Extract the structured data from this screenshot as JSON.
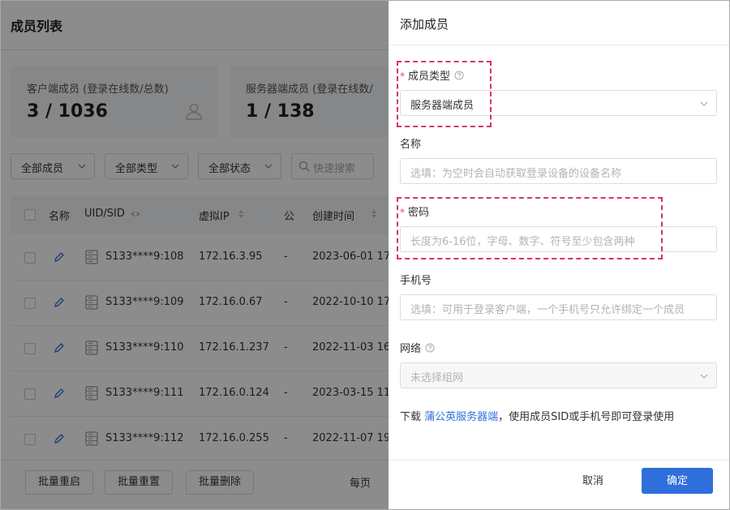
{
  "page": {
    "title": "成员列表",
    "stats": [
      {
        "label": "客户端成员 (登录在线数/总数)",
        "value": "3 / 1036"
      },
      {
        "label": "服务器端成员 (登录在线数/",
        "value": "1 / 138"
      }
    ],
    "filters": [
      "全部成员",
      "全部类型",
      "全部状态"
    ],
    "search_placeholder": "快速搜索",
    "columns": {
      "name": "名称",
      "uid": "UID/SID",
      "ip": "虚拟IP",
      "pub": "公",
      "created": "创建时间"
    },
    "rows": [
      {
        "sid": "S133****9:108",
        "ip": "172.16.3.95",
        "pub": "-",
        "created": "2023-06-01 17"
      },
      {
        "sid": "S133****9:109",
        "ip": "172.16.0.67",
        "pub": "-",
        "created": "2022-10-10 17"
      },
      {
        "sid": "S133****9:110",
        "ip": "172.16.1.237",
        "pub": "-",
        "created": "2022-11-03 16"
      },
      {
        "sid": "S133****9:111",
        "ip": "172.16.0.124",
        "pub": "-",
        "created": "2023-03-15 11"
      },
      {
        "sid": "S133****9:112",
        "ip": "172.16.0.255",
        "pub": "-",
        "created": "2022-11-07 19"
      }
    ],
    "footer": {
      "batch_restart": "批量重启",
      "batch_reset": "批量重置",
      "batch_delete": "批量删除",
      "per_page": "每页"
    }
  },
  "drawer": {
    "title": "添加成员",
    "member_type": {
      "label": "成员类型",
      "value": "服务器端成员"
    },
    "name": {
      "label": "名称",
      "placeholder": "选填：为空时会自动获取登录设备的设备名称"
    },
    "password": {
      "label": "密码",
      "placeholder": "长度为6-16位，字母、数字、符号至少包含两种"
    },
    "phone": {
      "label": "手机号",
      "placeholder": "选填：可用于登录客户端，一个手机号只允许绑定一个成员"
    },
    "network": {
      "label": "网络",
      "placeholder": "未选择组网"
    },
    "download": {
      "prefix": "下载 ",
      "link": "蒲公英服务器端",
      "suffix": "，使用成员SID或手机号即可登录使用"
    },
    "cancel": "取消",
    "confirm": "确定"
  },
  "colors": {
    "accent": "#2f6fdb",
    "required": "#e5484d",
    "highlight": "#d6336c"
  },
  "icons": [
    "user-icon",
    "chevron-down-icon",
    "search-icon",
    "eye-icon",
    "sort-icon",
    "edit-icon",
    "server-icon",
    "help-icon"
  ]
}
